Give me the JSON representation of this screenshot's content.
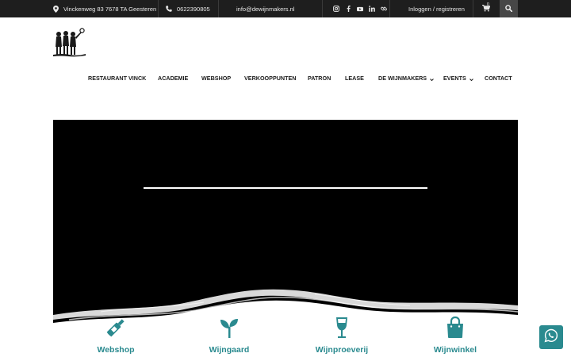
{
  "topbar": {
    "address": "Vinckenweg 83 7678 TA Geesteren",
    "phone": "0622390805",
    "email": "info@dewijnmakers.nl",
    "social_icons": [
      "instagram-icon",
      "facebook-icon",
      "youtube-icon",
      "linkedin-icon",
      "link-icon"
    ],
    "login_label": "Inloggen / registreren",
    "cart_count": "0"
  },
  "nav": {
    "items": [
      {
        "label": "RESTAURANT VINCK"
      },
      {
        "label": "ACADEMIE"
      },
      {
        "label": "WEBSHOP"
      },
      {
        "label": "VERKOOPPUNTEN"
      },
      {
        "label": "PATRON"
      },
      {
        "label": "LEASE"
      },
      {
        "label": "DE WIJNMAKERS"
      },
      {
        "label": "EVENTS"
      },
      {
        "label": "CONTACT"
      }
    ]
  },
  "features": [
    {
      "label": "Webshop",
      "icon": "wine-bottle-icon"
    },
    {
      "label": "Wijngaard",
      "icon": "seedling-icon"
    },
    {
      "label": "Wijnproeverij",
      "icon": "wine-glass-icon"
    },
    {
      "label": "Wijnwinkel",
      "icon": "shopping-bag-icon"
    }
  ],
  "colors": {
    "topbar_bg": "#1e1e1e",
    "accent": "#2a8a8f",
    "hero_bg": "#000000"
  }
}
